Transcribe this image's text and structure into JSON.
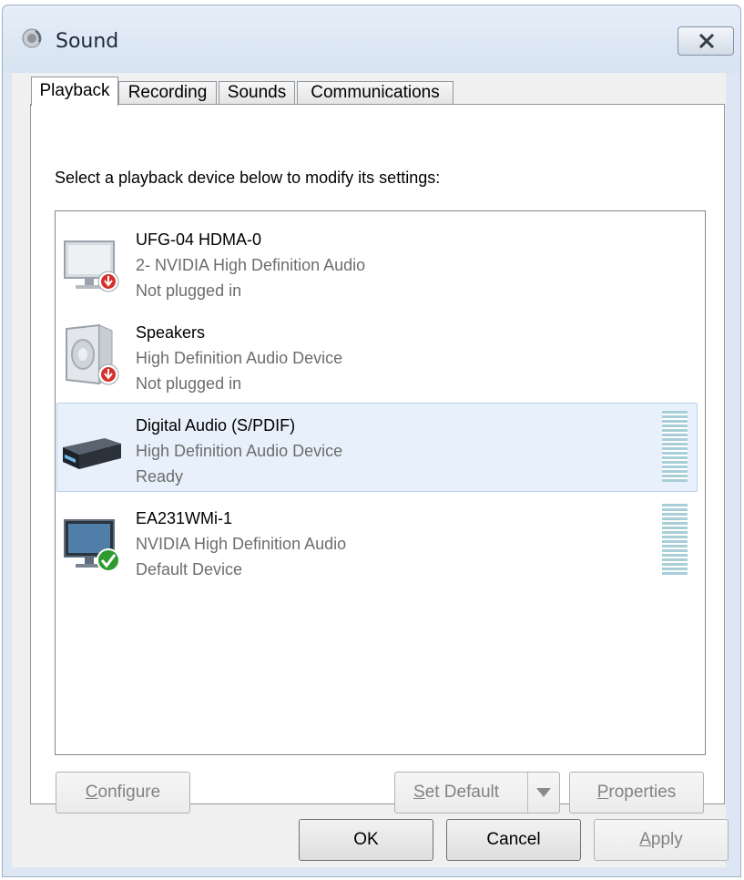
{
  "window": {
    "title": "Sound",
    "icon": "speaker-icon",
    "close_icon": "close-icon"
  },
  "tabs": [
    {
      "label": "Playback",
      "active": true
    },
    {
      "label": "Recording",
      "active": false
    },
    {
      "label": "Sounds",
      "active": false
    },
    {
      "label": "Communications",
      "active": false
    }
  ],
  "instruction": "Select a playback device below to modify its settings:",
  "devices": [
    {
      "name": "UFG-04 HDMA-0",
      "description": "2- NVIDIA High Definition Audio",
      "status": "Not plugged in",
      "icon": "monitor-icon",
      "badge": "unplugged-badge-icon"
    },
    {
      "name": "Speakers",
      "description": "High Definition Audio Device",
      "status": "Not plugged in",
      "icon": "speaker-device-icon",
      "badge": "unplugged-badge-icon"
    },
    {
      "name": "Digital Audio (S/PDIF)",
      "description": "High Definition Audio Device",
      "status": "Ready",
      "icon": "digital-receiver-icon",
      "selected": true
    },
    {
      "name": "EA231WMi-1",
      "description": "NVIDIA High Definition Audio",
      "status": "Default Device",
      "icon": "monitor-icon",
      "badge": "default-check-icon"
    }
  ],
  "buttons": {
    "configure": {
      "accel": "C",
      "rest": "onfigure"
    },
    "set_default": {
      "accel": "S",
      "rest": "et Default"
    },
    "properties": {
      "accel": "P",
      "rest": "roperties"
    },
    "ok": "OK",
    "cancel": "Cancel",
    "apply": {
      "accel": "A",
      "rest": "pply"
    }
  },
  "colors": {
    "selection_bg": "#e8f1fb",
    "meter": "#a8cfd8",
    "unplugged_badge": "#d4312b",
    "default_check": "#2f9a2f"
  }
}
